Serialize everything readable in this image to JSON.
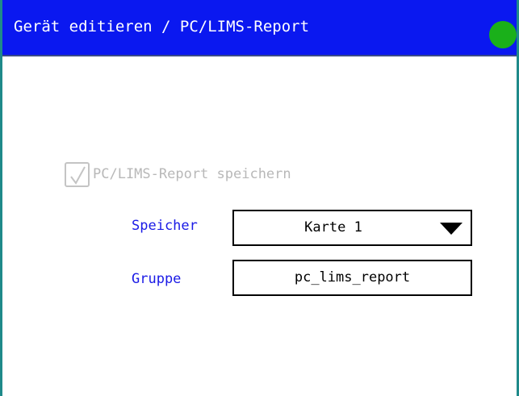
{
  "window": {
    "title": "Gerät editieren / PC/LIMS-Report",
    "status_color": "#1ab01a",
    "title_bg": "#0a18f0"
  },
  "form": {
    "save_report": {
      "label": "PC/LIMS-Report speichern",
      "checked": true,
      "enabled": false
    },
    "speicher": {
      "label": "Speicher",
      "value": "Karte 1",
      "icon": "triangle-down-icon"
    },
    "gruppe": {
      "label": "Gruppe",
      "value": "pc_lims_report"
    }
  }
}
